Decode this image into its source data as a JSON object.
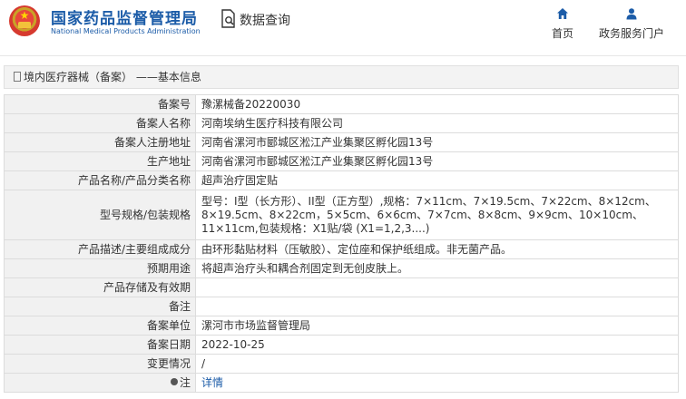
{
  "header": {
    "brand_cn": "国家药品监督管理局",
    "brand_en": "National Medical Products Administration",
    "query_label": "数据查询",
    "nav": {
      "home": "首页",
      "portal": "政务服务门户"
    }
  },
  "section": {
    "title": "境内医疗器械（备案） ——基本信息"
  },
  "record": {
    "rows": [
      {
        "label": "备案号",
        "value": "豫漯械备20220030"
      },
      {
        "label": "备案人名称",
        "value": "河南埃纳生医疗科技有限公司"
      },
      {
        "label": "备案人注册地址",
        "value": "河南省漯河市郾城区淞江产业集聚区孵化园13号"
      },
      {
        "label": "生产地址",
        "value": "河南省漯河市郾城区淞江产业集聚区孵化园13号"
      },
      {
        "label": "产品名称/产品分类名称",
        "value": "超声治疗固定贴"
      },
      {
        "label": "型号规格/包装规格",
        "value": "型号：I型（长方形）、II型（正方型）,规格：7×11cm、7×19.5cm、7×22cm、8×12cm、8×19.5cm、8×22cm，5×5cm、6×6cm、7×7cm、8×8cm、9×9cm、10×10cm、11×11cm,包装规格：X1贴/袋 (X1=1,2,3....)"
      },
      {
        "label": "产品描述/主要组成成分",
        "value": "由环形黏贴材料（压敏胶）、定位座和保护纸组成。非无菌产品。"
      },
      {
        "label": "预期用途",
        "value": "将超声治疗头和耦合剂固定到无创皮肤上。"
      },
      {
        "label": "产品存储及有效期",
        "value": ""
      },
      {
        "label": "备注",
        "value": ""
      },
      {
        "label": "备案单位",
        "value": "漯河市市场监督管理局"
      },
      {
        "label": "备案日期",
        "value": "2022-10-25"
      },
      {
        "label": "变更情况",
        "value": "/"
      },
      {
        "label": "注",
        "value": "详情"
      }
    ]
  },
  "colors": {
    "brand_blue": "#1c5ca8",
    "label_bg": "#f1f1f1",
    "border": "#dcdcdc"
  },
  "icons": {
    "emblem": "national-emblem-icon",
    "query": "document-search-icon",
    "home": "home-icon",
    "portal": "user-icon",
    "section": "document-icon",
    "note": "lightbulb-icon"
  }
}
